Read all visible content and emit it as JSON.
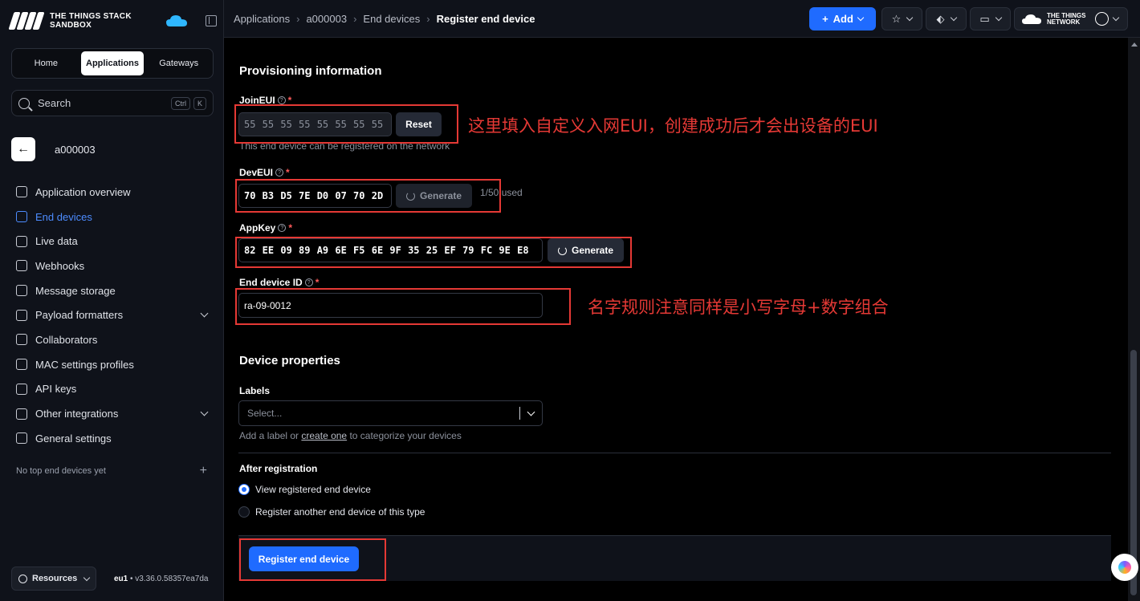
{
  "brand": {
    "line1": "THE THINGS STACK",
    "line2": "SANDBOX"
  },
  "sidebar": {
    "tabs": [
      {
        "label": "Home",
        "active": false
      },
      {
        "label": "Applications",
        "active": true
      },
      {
        "label": "Gateways",
        "active": false
      }
    ],
    "search": {
      "label": "Search",
      "kbd1": "Ctrl",
      "kbd2": "K"
    },
    "app_name": "a000003",
    "items": [
      {
        "label": "Application overview",
        "icon": "grid-icon",
        "active": false,
        "expandable": false
      },
      {
        "label": "End devices",
        "icon": "chip-icon",
        "active": true,
        "expandable": false
      },
      {
        "label": "Live data",
        "icon": "list-icon",
        "active": false,
        "expandable": false
      },
      {
        "label": "Webhooks",
        "icon": "webhook-icon",
        "active": false,
        "expandable": false
      },
      {
        "label": "Message storage",
        "icon": "database-icon",
        "active": false,
        "expandable": false
      },
      {
        "label": "Payload formatters",
        "icon": "code-icon",
        "active": false,
        "expandable": true
      },
      {
        "label": "Collaborators",
        "icon": "people-icon",
        "active": false,
        "expandable": false
      },
      {
        "label": "MAC settings profiles",
        "icon": "user-plus-icon",
        "active": false,
        "expandable": false
      },
      {
        "label": "API keys",
        "icon": "key-icon",
        "active": false,
        "expandable": false
      },
      {
        "label": "Other integrations",
        "icon": "integration-icon",
        "active": false,
        "expandable": true
      },
      {
        "label": "General settings",
        "icon": "gear-icon",
        "active": false,
        "expandable": false
      }
    ],
    "top_devices": "No top end devices yet",
    "resources": "Resources",
    "version_region": "eu1",
    "version_sep": " • ",
    "version": "v3.36.0.58357ea7da"
  },
  "topbar": {
    "crumbs": [
      "Applications",
      "a000003",
      "End devices"
    ],
    "current": "Register end device",
    "add_label": "Add",
    "ttn_line1": "THE THINGS",
    "ttn_line2": "NETWORK"
  },
  "form": {
    "section1": "Provisioning information",
    "join_eui": {
      "label": "JoinEUI",
      "value": "55 55 55 55 55 55 55 55",
      "button": "Reset",
      "hint": "This end device can be registered on the network"
    },
    "dev_eui": {
      "label": "DevEUI",
      "value": "70 B3 D5 7E D0 07 70 2D",
      "button": "Generate",
      "usage": "1/50 used"
    },
    "app_key": {
      "label": "AppKey",
      "value": "82 EE 09 89 A9 6E F5 6E 9F 35 25 EF 79 FC 9E E8",
      "button": "Generate"
    },
    "device_id": {
      "label": "End device ID",
      "value": "ra-09-0012"
    },
    "section2": "Device properties",
    "labels": {
      "label": "Labels",
      "placeholder": "Select...",
      "hint_pre": "Add a label or ",
      "hint_link": "create one",
      "hint_post": " to categorize your devices"
    },
    "after": {
      "label": "After registration",
      "options": [
        {
          "label": "View registered end device",
          "selected": true
        },
        {
          "label": "Register another end device of this type",
          "selected": false
        }
      ]
    },
    "submit": "Register end device"
  },
  "annotations": {
    "note1": "这里填入自定义入网EUI，创建成功后才会出设备的EUI",
    "note2": "名字规则注意同样是小写字母+数字组合"
  }
}
